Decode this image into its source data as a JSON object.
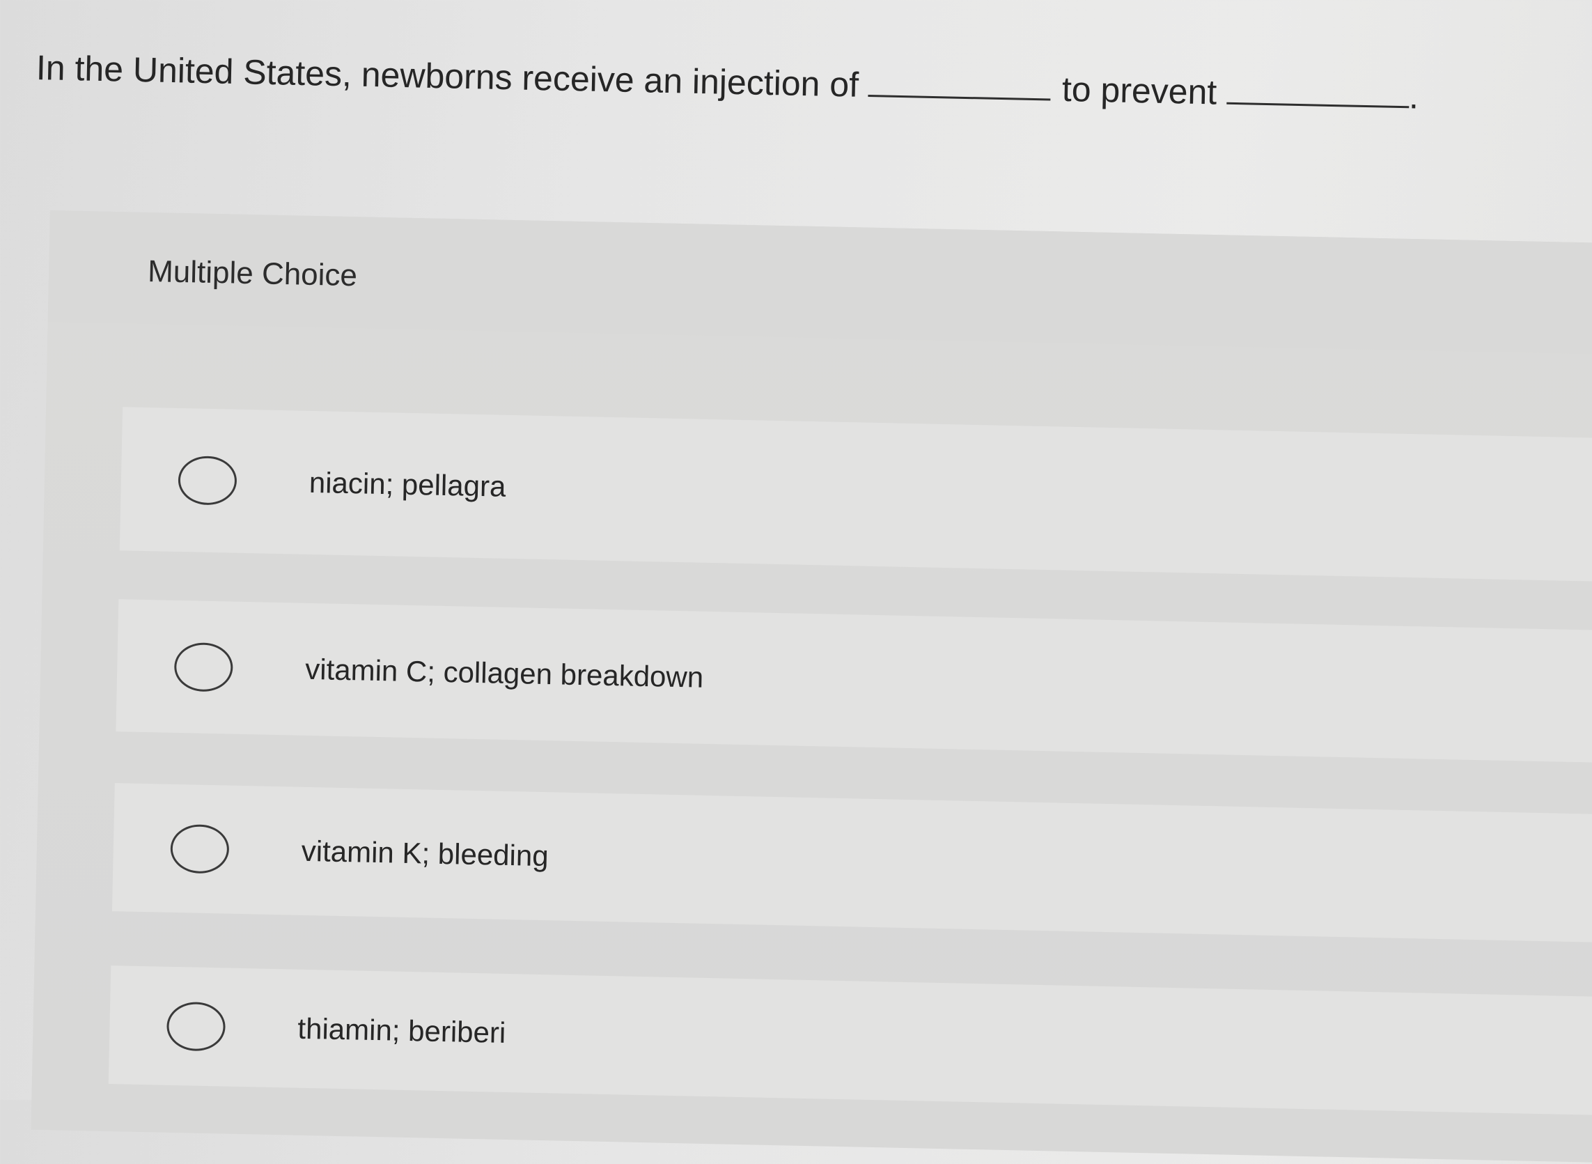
{
  "question": {
    "text_before": "In the United States, newborns receive an injection of",
    "text_middle": "to prevent",
    "text_end": "."
  },
  "panel": {
    "label": "Multiple Choice"
  },
  "options": [
    {
      "label": "niacin; pellagra",
      "selected": false
    },
    {
      "label": "vitamin C; collagen breakdown",
      "selected": false
    },
    {
      "label": "vitamin K; bleeding",
      "selected": false
    },
    {
      "label": "thiamin; beriberi",
      "selected": false
    }
  ],
  "colors": {
    "background": "#e6e6e6",
    "panel": "#d9d9d8",
    "option_row": "#e2e2e1",
    "text": "#262626"
  }
}
